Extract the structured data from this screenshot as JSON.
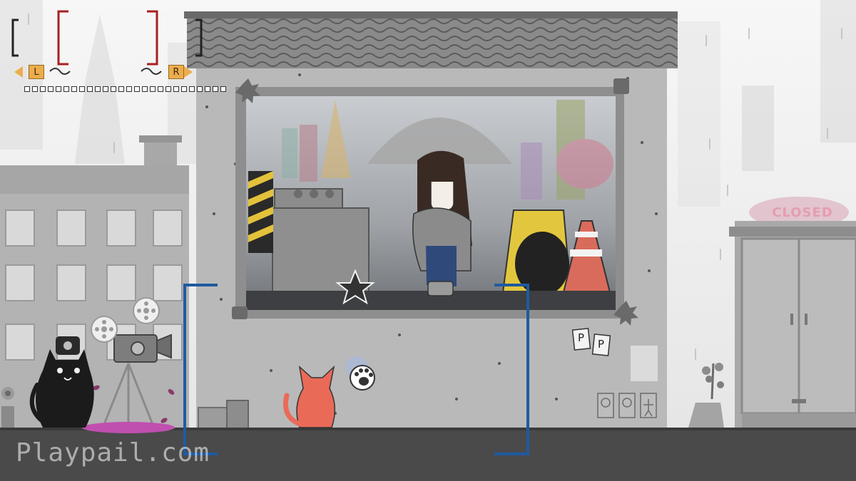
{
  "watermark": "Playpail.com",
  "shop_sign": "CLOSED",
  "hud": {
    "left_key": "L",
    "right_key": "R",
    "accent_color": "#ecad4c",
    "bracket_color": "#a82020",
    "progress_segments_total": 9,
    "progress_segments_filled": 0
  },
  "signs": {
    "p_card_1": "P",
    "p_card_2": "P"
  },
  "colors": {
    "frame_blue": "#1f5aa0",
    "cat_orange": "#ea6a58",
    "cat_black": "#1b1b1b",
    "ground": "#4a4a4a"
  },
  "icons": [
    "paw-icon",
    "star-icon",
    "film-reel-icon",
    "camera-icon",
    "flower-icon"
  ]
}
